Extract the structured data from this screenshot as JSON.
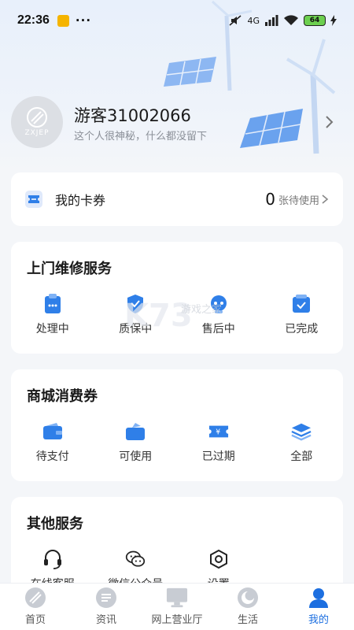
{
  "status_bar": {
    "time": "22:36",
    "dots": "···",
    "network": "4G",
    "battery": "64"
  },
  "profile": {
    "avatar_text": "ZXJEP",
    "name": "游客31002066",
    "signature": "这个人很神秘，什么都没留下"
  },
  "coupon": {
    "label": "我的卡券",
    "count": "0",
    "tail": "张待使用"
  },
  "repair": {
    "title": "上门维修服务",
    "items": [
      {
        "label": "处理中",
        "icon": "clipboard-icon"
      },
      {
        "label": "质保中",
        "icon": "shield-icon"
      },
      {
        "label": "售后中",
        "icon": "robot-icon"
      },
      {
        "label": "已完成",
        "icon": "check-box-icon"
      }
    ]
  },
  "voucher": {
    "title": "商城消费券",
    "items": [
      {
        "label": "待支付",
        "icon": "wallet-icon"
      },
      {
        "label": "可使用",
        "icon": "bag-icon"
      },
      {
        "label": "已过期",
        "icon": "ticket-icon"
      },
      {
        "label": "全部",
        "icon": "layers-icon"
      }
    ]
  },
  "other": {
    "title": "其他服务",
    "items": [
      {
        "label": "在线客服",
        "icon": "headset-icon"
      },
      {
        "label": "微信公众号",
        "icon": "wechat-icon"
      },
      {
        "label": "设置",
        "icon": "settings-icon"
      }
    ]
  },
  "watermark": {
    "text": "游戏之家"
  },
  "nav": {
    "items": [
      {
        "label": "首页",
        "icon": "home-icon"
      },
      {
        "label": "资讯",
        "icon": "news-icon"
      },
      {
        "label": "网上营业厅",
        "icon": "monitor-icon"
      },
      {
        "label": "生活",
        "icon": "life-icon"
      },
      {
        "label": "我的",
        "icon": "user-icon"
      }
    ],
    "active_index": 4
  },
  "colors": {
    "accent": "#1d6fe0",
    "icon_blue": "#2f7fe8",
    "page_bg": "#f4f6f9"
  }
}
